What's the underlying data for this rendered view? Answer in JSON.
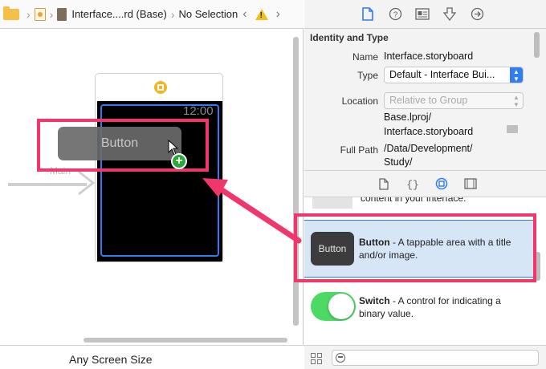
{
  "jump_bar": {
    "breadcrumb_file": "Interface....rd (Base)",
    "breadcrumb_selection": "No Selection",
    "back_glyph": "‹",
    "forward_glyph": "›",
    "warning_glyph": "!"
  },
  "canvas": {
    "entry_label": "Main",
    "watch_time": "12:00",
    "drag_button_label": "Button",
    "plus_glyph": "+",
    "size_class_label": "Any Screen Size"
  },
  "inspector": {
    "tab_icons": [
      "file-icon",
      "help-icon",
      "identity-icon",
      "attributes-icon",
      "connections-icon"
    ],
    "section_title": "Identity and Type",
    "name_label": "Name",
    "name_value": "Interface.storyboard",
    "type_label": "Type",
    "type_value": "Default - Interface Bui...",
    "location_label": "Location",
    "location_value": "Relative to Group",
    "path_line1": "Base.lproj/",
    "path_line2": "Interface.storyboard",
    "full_path_label": "Full Path",
    "full_path_line1": "/Data/Development/",
    "full_path_line2": "Study/"
  },
  "library": {
    "tab_icons": [
      "file-template-icon",
      "code-snippet-icon",
      "object-library-icon",
      "media-library-icon"
    ],
    "prev_item_text": "content in your interface.",
    "button_item": {
      "thumb_label": "Button",
      "name": "Button",
      "description": " - A tappable area with a title and/or image."
    },
    "switch_item": {
      "name": "Switch",
      "description": " - A control for indicating a binary value."
    }
  },
  "colors": {
    "highlight": "#f0366b",
    "watch_frame": "#2d7cf5",
    "selection": "#d6e6f7",
    "switch_on": "#4cd964"
  }
}
